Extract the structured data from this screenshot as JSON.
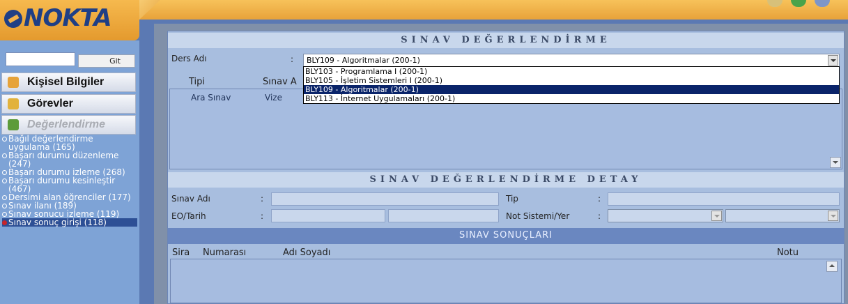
{
  "brand": {
    "logo_text": "NOKTA"
  },
  "header": {
    "icons": [
      "notebook-icon",
      "refresh-icon",
      "settings-icon"
    ]
  },
  "sidebar": {
    "search_placeholder": "",
    "go_label": "Git",
    "menu": [
      {
        "label": "Kişisel Bilgiler",
        "icon": "person-icon"
      },
      {
        "label": "Görevler",
        "icon": "tasks-icon"
      },
      {
        "label": "Değerlendirme",
        "icon": "chart-icon",
        "disabled": true
      }
    ],
    "sub_items": [
      {
        "label": "Bağıl değerlendirme uygulama (165)"
      },
      {
        "label": "Başarı durumu düzenleme (247)"
      },
      {
        "label": "Başarı durumu izleme (268)"
      },
      {
        "label": "Başarı durumu kesinleştir (467)"
      },
      {
        "label": "Dersimi alan öğrenciler (177)"
      },
      {
        "label": "Sınav ilanı (189)"
      },
      {
        "label": "Sınav sonucu izleme (119)"
      },
      {
        "label": "Sınav sonuç girişi (118)",
        "active": true
      }
    ]
  },
  "main": {
    "title": "SINAV DEĞERLENDİRME",
    "course_label": "Ders Adı",
    "colon": ":",
    "course_value": "BLY109 - Algoritmalar (200-1)",
    "course_options": [
      "BLY103 - Programlama I (200-1)",
      "BLY105 - İşletim Sistemleri I (200-1)",
      "BLY109 - Algoritmalar (200-1)",
      "BLY113 - İnternet Uygulamaları (200-1)"
    ],
    "selected_option_index": 2,
    "exam_columns": [
      "Tipi",
      "Sınav A"
    ],
    "exam_rows": [
      {
        "type": "Ara Sınav",
        "name": "Vize"
      }
    ],
    "detail_title": "SINAV DEĞERLENDİRME DETAY",
    "detail": {
      "exam_name_label": "Sınav Adı",
      "type_label": "Tip",
      "eo_date_label": "EO/Tarih",
      "grade_system_label": "Not Sistemi/Yer"
    },
    "results_title": "SINAV SONUÇLARI",
    "result_columns": {
      "order": "Sira",
      "number": "Numarası",
      "name": "Adı Soyadı",
      "grade": "Notu"
    }
  }
}
